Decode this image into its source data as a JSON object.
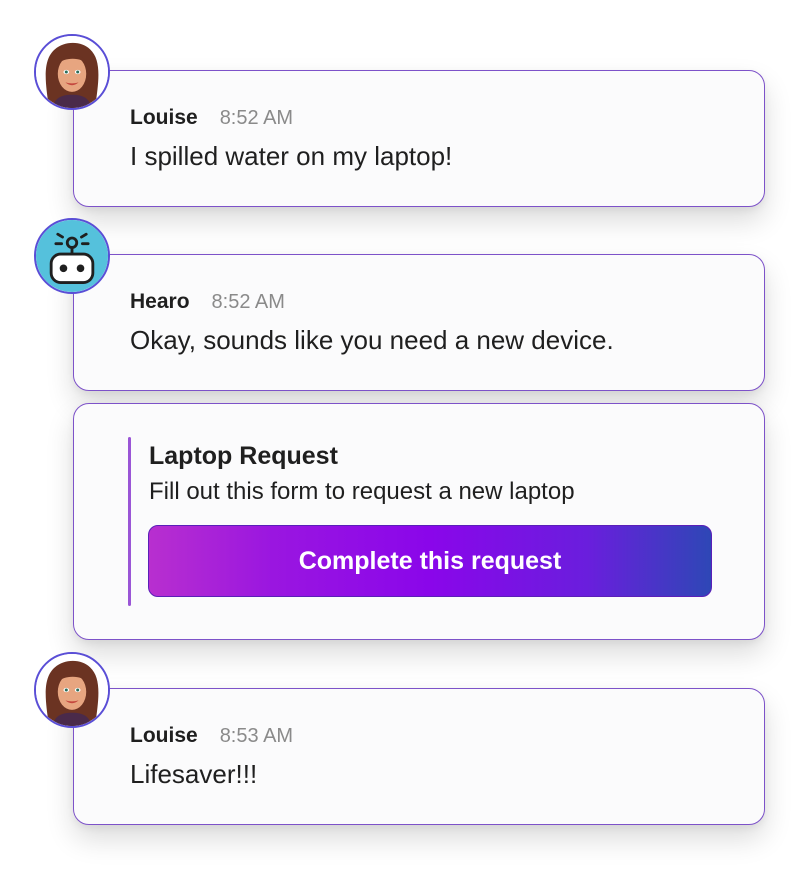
{
  "messages": [
    {
      "author": "Louise",
      "time": "8:52 AM",
      "text": "I spilled water on my laptop!"
    },
    {
      "author": "Hearo",
      "time": "8:52 AM",
      "text": "Okay, sounds like you need a new device."
    },
    {
      "author": "Louise",
      "time": "8:53 AM",
      "text": "Lifesaver!!!"
    }
  ],
  "attachment": {
    "title": "Laptop Request",
    "description": "Fill out this form to request a new laptop",
    "button_label": "Complete this request"
  },
  "icons": {
    "user_avatar": "user-avatar-icon",
    "bot_avatar": "robot-avatar-icon"
  },
  "colors": {
    "card_border": "#7d52c9",
    "button_gradient_start": "#b82fcf",
    "button_gradient_mid": "#8a06ea",
    "button_gradient_end": "#2e47b6",
    "bot_avatar_bg": "#55c1dc"
  }
}
